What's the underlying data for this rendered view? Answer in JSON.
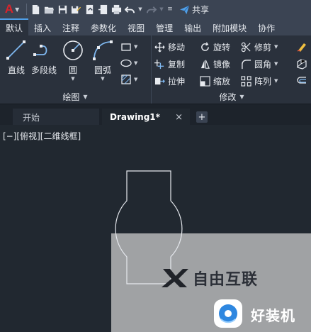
{
  "app": {
    "logo_letter": "A"
  },
  "qat": {
    "icons": [
      "new-file-icon",
      "open-folder-icon",
      "save-icon",
      "save-as-icon",
      "open-web-icon",
      "save-web-icon",
      "print-icon",
      "undo-icon",
      "redo-icon",
      "customize-icon"
    ],
    "share_label": "共享"
  },
  "tabs": [
    {
      "label": "默认",
      "active": true
    },
    {
      "label": "插入"
    },
    {
      "label": "注释"
    },
    {
      "label": "参数化"
    },
    {
      "label": "视图"
    },
    {
      "label": "管理"
    },
    {
      "label": "输出"
    },
    {
      "label": "附加模块"
    },
    {
      "label": "协作"
    }
  ],
  "draw_panel": {
    "title": "绘图",
    "tools": [
      {
        "label": "直线",
        "icon": "line-icon"
      },
      {
        "label": "多段线",
        "icon": "polyline-icon"
      },
      {
        "label": "圆",
        "icon": "circle-icon"
      },
      {
        "label": "圆弧",
        "icon": "arc-icon"
      }
    ],
    "small_tools": [
      "rectangle-icon",
      "ellipse-icon",
      "hatch-icon"
    ]
  },
  "modify_panel": {
    "title": "修改",
    "rows": [
      [
        {
          "label": "移动",
          "icon": "move-icon"
        },
        {
          "label": "旋转",
          "icon": "rotate-icon"
        },
        {
          "label": "修剪",
          "icon": "trim-icon"
        }
      ],
      [
        {
          "label": "复制",
          "icon": "copy-icon"
        },
        {
          "label": "镜像",
          "icon": "mirror-icon"
        },
        {
          "label": "圆角",
          "icon": "fillet-icon"
        }
      ],
      [
        {
          "label": "拉伸",
          "icon": "stretch-icon"
        },
        {
          "label": "缩放",
          "icon": "scale-icon"
        },
        {
          "label": "阵列",
          "icon": "array-icon"
        }
      ]
    ],
    "right_icons": [
      "erase-icon",
      "explode-icon",
      "offset-icon"
    ]
  },
  "doc_tabs": {
    "start": "开始",
    "drawing": "Drawing1*",
    "close": "×",
    "add": "+"
  },
  "viewport": {
    "label": "[−][俯视][二维线框]"
  },
  "colors": {
    "ribbon_bg": "#2a313c",
    "toolbar_bg": "#3b4453",
    "canvas_bg": "#212830",
    "accent": "#4f9fe8",
    "logo_red": "#d9242b",
    "overlay_gray": "#a0a2a4"
  },
  "watermark": {
    "brand1": "自由互联",
    "brand2": "好装机"
  }
}
